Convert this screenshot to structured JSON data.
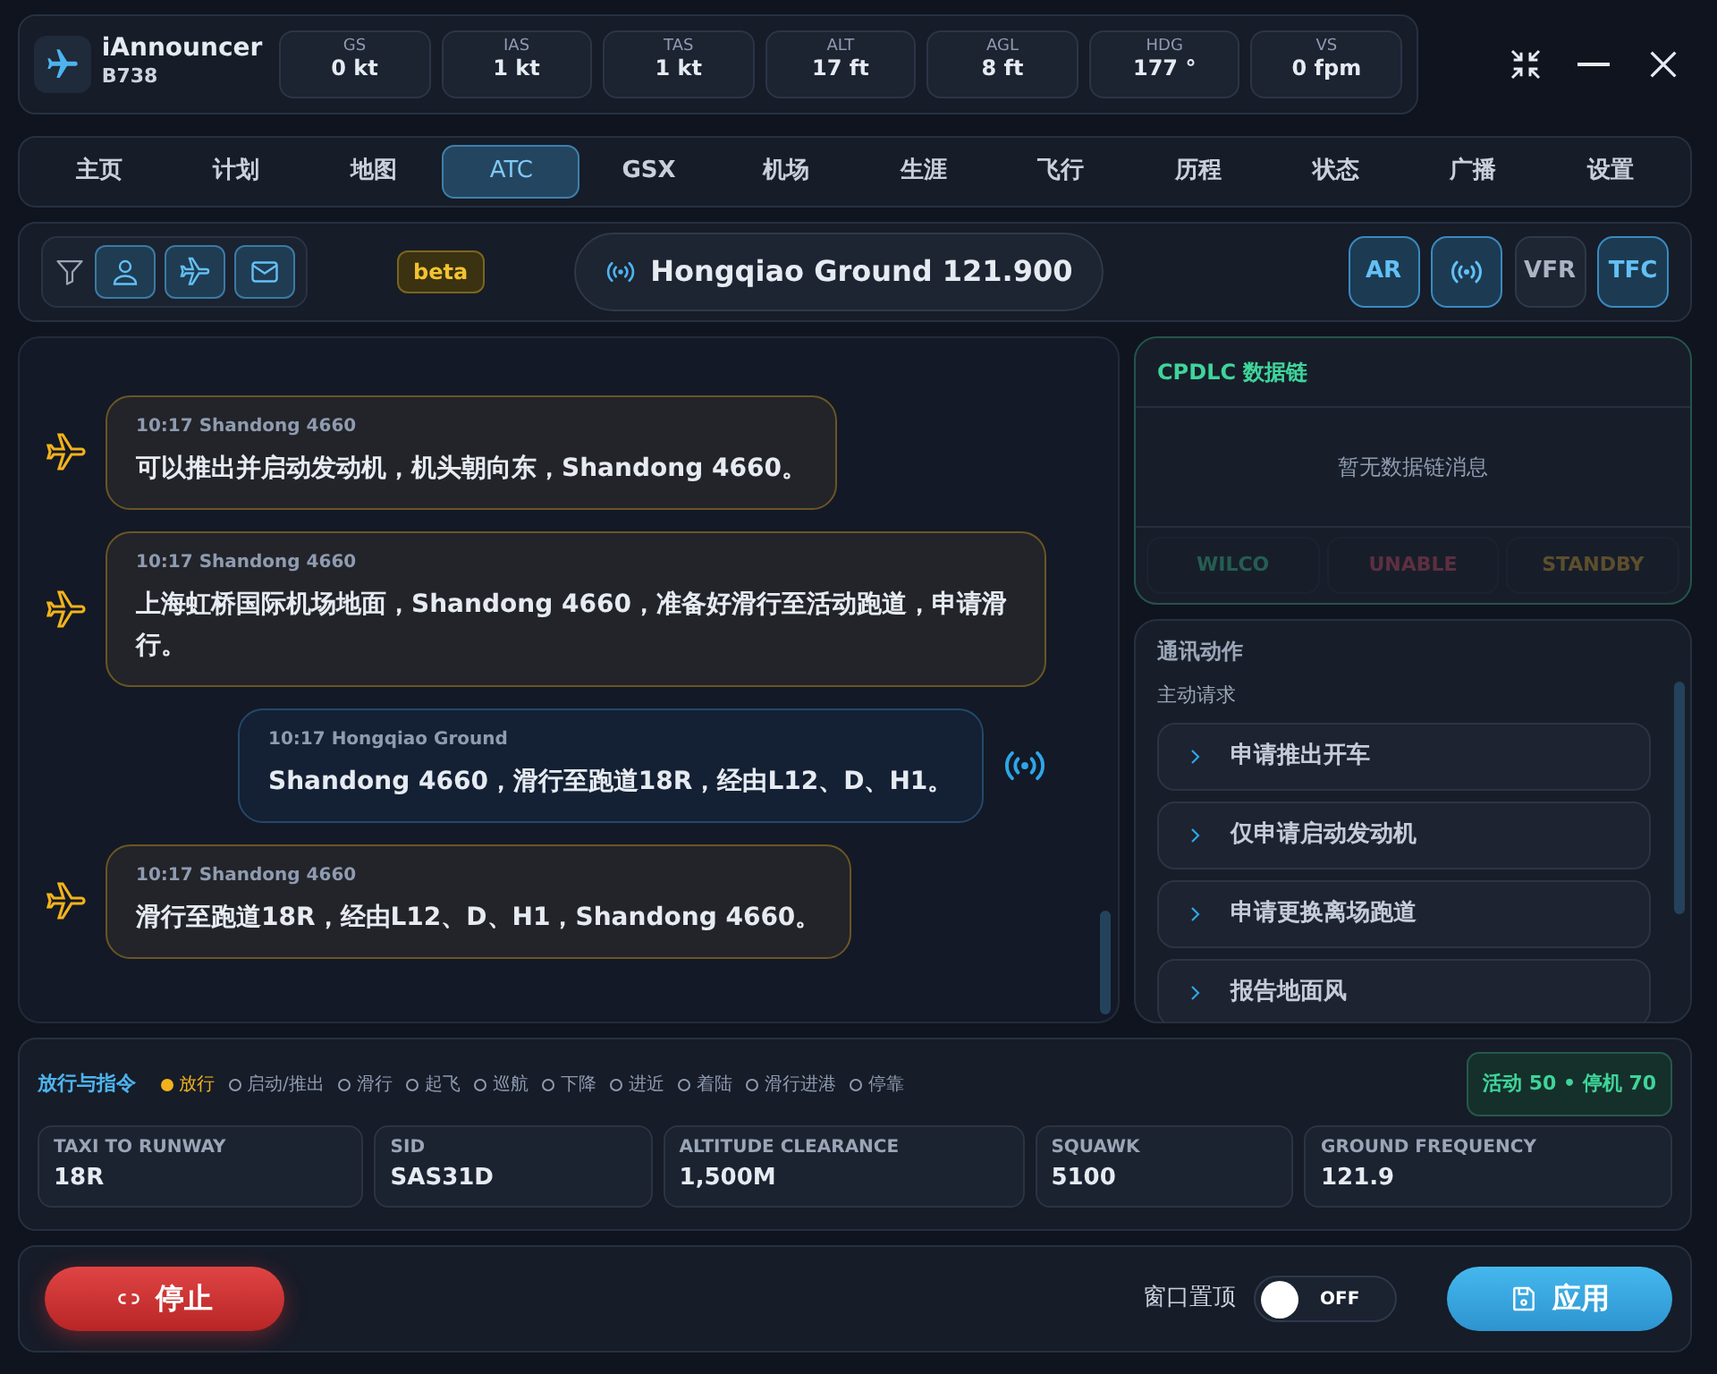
{
  "app": {
    "name": "iAnnouncer",
    "aircraft": "B738"
  },
  "readouts": [
    {
      "label": "GS",
      "value": "0 kt"
    },
    {
      "label": "IAS",
      "value": "1 kt"
    },
    {
      "label": "TAS",
      "value": "1 kt"
    },
    {
      "label": "ALT",
      "value": "17 ft"
    },
    {
      "label": "AGL",
      "value": "8 ft"
    },
    {
      "label": "HDG",
      "value": "177 °"
    },
    {
      "label": "VS",
      "value": "0 fpm"
    }
  ],
  "tabs": [
    {
      "label": "主页",
      "selected": false
    },
    {
      "label": "计划",
      "selected": false
    },
    {
      "label": "地图",
      "selected": false
    },
    {
      "label": "ATC",
      "selected": true
    },
    {
      "label": "GSX",
      "selected": false
    },
    {
      "label": "机场",
      "selected": false
    },
    {
      "label": "生涯",
      "selected": false
    },
    {
      "label": "飞行",
      "selected": false
    },
    {
      "label": "历程",
      "selected": false
    },
    {
      "label": "状态",
      "selected": false
    },
    {
      "label": "广播",
      "selected": false
    },
    {
      "label": "设置",
      "selected": false
    }
  ],
  "filters": [
    {
      "kind": "person",
      "selected": true
    },
    {
      "kind": "plane",
      "selected": true
    },
    {
      "kind": "mail",
      "selected": true
    }
  ],
  "beta_badge": "beta",
  "frequency": "Hongqiao Ground 121.900",
  "mode_buttons": [
    {
      "kind": "text",
      "label": "AR",
      "selected": true
    },
    {
      "kind": "radio",
      "selected": true
    },
    {
      "kind": "text",
      "label": "VFR",
      "selected": false
    },
    {
      "kind": "text",
      "label": "TFC",
      "selected": true
    }
  ],
  "messages": [
    {
      "kind": "pilot",
      "time": "10:17",
      "sender": "Shandong 4660",
      "text": "可以推出并启动发动机，机头朝向东，Shandong 4660。"
    },
    {
      "kind": "pilot",
      "time": "10:17",
      "sender": "Shandong 4660",
      "text": "上海虹桥国际机场地面，Shandong 4660，准备好滑行至活动跑道，申请滑行。"
    },
    {
      "kind": "atc",
      "time": "10:17",
      "sender": "Hongqiao Ground",
      "text": "Shandong 4660，滑行至跑道18R，经由L12、D、H1。"
    },
    {
      "kind": "pilot",
      "time": "10:17",
      "sender": "Shandong 4660",
      "text": "滑行至跑道18R，经由L12、D、H1，Shandong 4660。"
    }
  ],
  "cpdlc": {
    "title": "CPDLC 数据链",
    "empty_message": "暂无数据链消息",
    "responses": [
      {
        "kind": "wilco",
        "label": "WILCO",
        "disabled": true
      },
      {
        "kind": "unable",
        "label": "UNABLE",
        "disabled": true
      },
      {
        "kind": "standby",
        "label": "STANDBY",
        "disabled": true
      }
    ]
  },
  "actions": {
    "title": "通讯动作",
    "group": "主动请求",
    "items": [
      "申请推出开车",
      "仅申请启动发动机",
      "申请更换离场跑道",
      "报告地面风"
    ]
  },
  "instructions": {
    "title": "放行与指令",
    "phases": [
      {
        "label": "放行",
        "selected": true
      },
      {
        "label": "启动/推出",
        "selected": false
      },
      {
        "label": "滑行",
        "selected": false
      },
      {
        "label": "起飞",
        "selected": false
      },
      {
        "label": "巡航",
        "selected": false
      },
      {
        "label": "下降",
        "selected": false
      },
      {
        "label": "进近",
        "selected": false
      },
      {
        "label": "着陆",
        "selected": false
      },
      {
        "label": "滑行进港",
        "selected": false
      },
      {
        "label": "停靠",
        "selected": false
      }
    ],
    "counter": "活动 50 • 停机 70",
    "fields": [
      {
        "label": "TAXI TO RUNWAY",
        "value": "18R"
      },
      {
        "label": "SID",
        "value": "SAS31D"
      },
      {
        "label": "ALTITUDE CLEARANCE",
        "value": "1,500M"
      },
      {
        "label": "SQUAWK",
        "value": "5100"
      },
      {
        "label": "GROUND FREQUENCY",
        "value": "121.9"
      }
    ]
  },
  "footer": {
    "stop_button": "停止",
    "pin_label": "窗口置顶",
    "pin_toggle": {
      "on": false,
      "label": "OFF"
    },
    "apply_button": "应用"
  }
}
